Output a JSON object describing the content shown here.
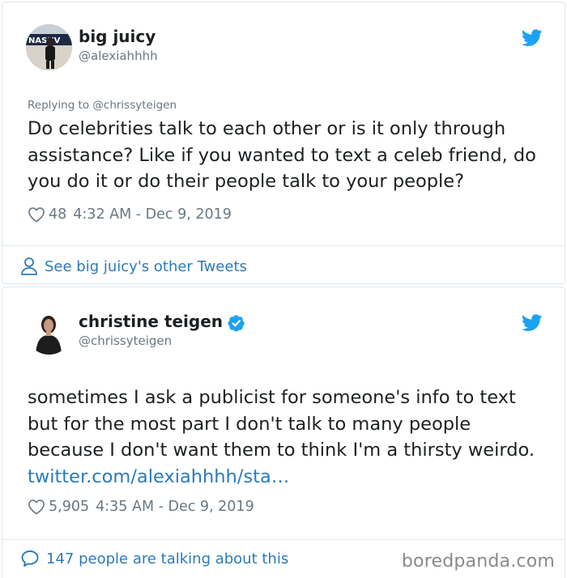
{
  "reply_tweet": {
    "author_name": "big juicy",
    "author_handle": "@alexiahhhh",
    "avatar_sign_text": "NASHV",
    "replying_to": "Replying to @chrissyteigen",
    "text": "Do celebrities talk to each other or is it only through assistance? Like if you wanted to text a celeb friend, do you do it or do their people talk to your people?",
    "likes": "48",
    "timestamp": "4:32 AM - Dec 9, 2019",
    "footer_link": "See big juicy's other Tweets",
    "icons": {
      "logo": "twitter-bird-icon",
      "like": "heart-icon",
      "profile": "person-icon"
    }
  },
  "main_tweet": {
    "author_name": "christine teigen",
    "author_handle": "@chrissyteigen",
    "text": "sometimes I ask a publicist for someone's info to text but for the most part I don't talk to many people because I don't want them to think I'm a thirsty weirdo.",
    "link_text": "twitter.com/alexiahhhh/sta…",
    "likes": "5,905",
    "timestamp": "4:35 AM - Dec 9, 2019",
    "footer_link": "147 people are talking about this",
    "icons": {
      "logo": "twitter-bird-icon",
      "verified": "verified-badge-icon",
      "like": "heart-icon",
      "reply": "speech-bubble-icon"
    }
  },
  "watermark": "boredpanda.com",
  "colors": {
    "text": "#1c2022",
    "muted": "#697882",
    "link": "#2b7bb9",
    "twitter_blue": "#1da1f2",
    "border": "#e1e8ed"
  }
}
